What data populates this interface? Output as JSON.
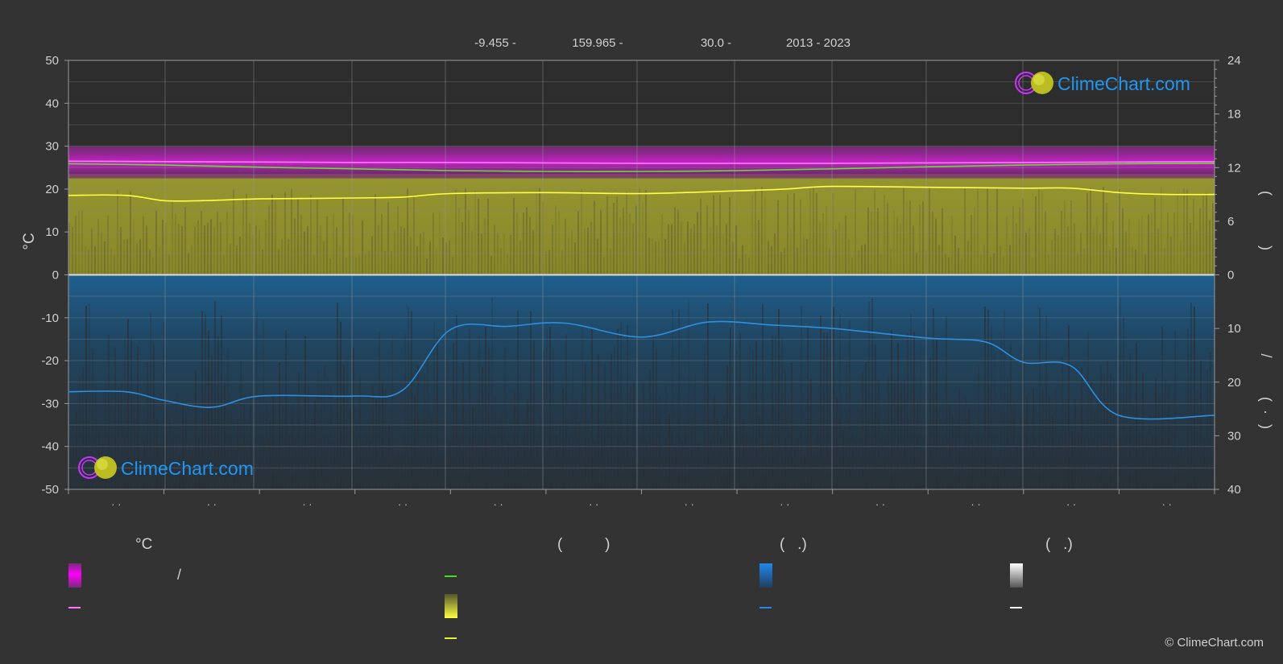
{
  "header": {
    "lat": "-9.455 -",
    "lon": "159.965 -",
    "elev": "30.0 -",
    "years": "2013 - 2023"
  },
  "brand": {
    "name": "ClimeChart.com",
    "copyright": "© ClimeChart.com"
  },
  "chart_data": {
    "type": "line",
    "ylabel_left": "°C",
    "ylim_left": [
      -50,
      50
    ],
    "yticks_left": [
      50,
      40,
      30,
      20,
      10,
      0,
      -10,
      -20,
      -30,
      -40,
      -50
    ],
    "yticks_right_top": [
      24,
      18,
      12,
      6,
      0
    ],
    "yticks_right_bottom": [
      10,
      20,
      30,
      40
    ],
    "ylim_right_top": [
      0,
      24
    ],
    "ylim_right_bottom": [
      0,
      40
    ],
    "x_months": 12,
    "x_month_labels": [
      "· ·",
      "· ·",
      "· ·",
      "· ·",
      "· ·",
      "· ·",
      "· ·",
      "· ·",
      "· ·",
      "· ·",
      "· ·",
      "· ·"
    ],
    "right_axis_glyphs_top": [
      "(",
      ")"
    ],
    "right_axis_glyphs_bottom": [
      "/",
      "(",
      "·",
      ")"
    ],
    "grid": true,
    "series": [
      {
        "axis": "left °C",
        "color": "#ff77ff",
        "x": [
          0,
          1,
          2,
          3,
          4,
          5,
          6,
          7,
          8,
          9,
          10,
          11,
          12
        ],
        "values": [
          26.5,
          26.4,
          26.3,
          26.2,
          26.2,
          26.1,
          26.0,
          26.0,
          26.0,
          26.1,
          26.2,
          26.3,
          26.4
        ]
      },
      {
        "axis": "left °C",
        "color": "#66dd33",
        "x": [
          0,
          1,
          2,
          3,
          4,
          5,
          6,
          7,
          8,
          9,
          10,
          11,
          12
        ],
        "values": [
          25.9,
          25.6,
          25.1,
          24.7,
          24.3,
          24.1,
          24.1,
          24.3,
          24.7,
          25.2,
          25.6,
          25.9,
          26.0
        ]
      },
      {
        "axis": "right hours 0-24",
        "color": "#ffff44",
        "x": [
          0,
          0.6,
          1.0,
          1.4,
          2.0,
          3.0,
          3.5,
          4.0,
          5.0,
          6.0,
          7.0,
          7.5,
          8.0,
          9.0,
          10.0,
          10.5,
          11.0,
          11.5,
          12.0
        ],
        "values": [
          8.9,
          8.9,
          8.3,
          8.3,
          8.5,
          8.6,
          8.7,
          9.1,
          9.2,
          9.1,
          9.4,
          9.6,
          9.9,
          9.8,
          9.7,
          9.7,
          9.2,
          9.0,
          9.0
        ]
      },
      {
        "axis": "right 0-40 inverted",
        "color": "#2f8fe0",
        "x": [
          0,
          0.6,
          1.0,
          1.5,
          2.0,
          3.0,
          3.5,
          4.0,
          4.6,
          5.2,
          6.0,
          6.7,
          7.4,
          8.0,
          9.0,
          9.6,
          10.0,
          10.5,
          11.0,
          12.0
        ],
        "values": [
          21.8,
          21.8,
          23.4,
          24.7,
          22.6,
          22.6,
          21.5,
          10.2,
          9.6,
          9.0,
          11.6,
          8.8,
          9.4,
          10.0,
          11.8,
          12.5,
          16.3,
          17.0,
          26.2,
          26.2
        ]
      }
    ]
  },
  "legend": {
    "col1": {
      "title": "°C",
      "slash": "/",
      "swatch_color": "#ff00ff",
      "line_color": "#ff77ff"
    },
    "col2": {
      "title": "(          )",
      "line1_color": "#44dd22",
      "swatch_color": "#ffff44",
      "line2_color": "#eeee33"
    },
    "col3": {
      "title": "(   .)",
      "swatch_color": "#2288ee",
      "line_color": "#2288ee"
    },
    "col4": {
      "title": "(   .)",
      "swatch_color": "#ffffff",
      "line_color": "#ffffff"
    }
  }
}
